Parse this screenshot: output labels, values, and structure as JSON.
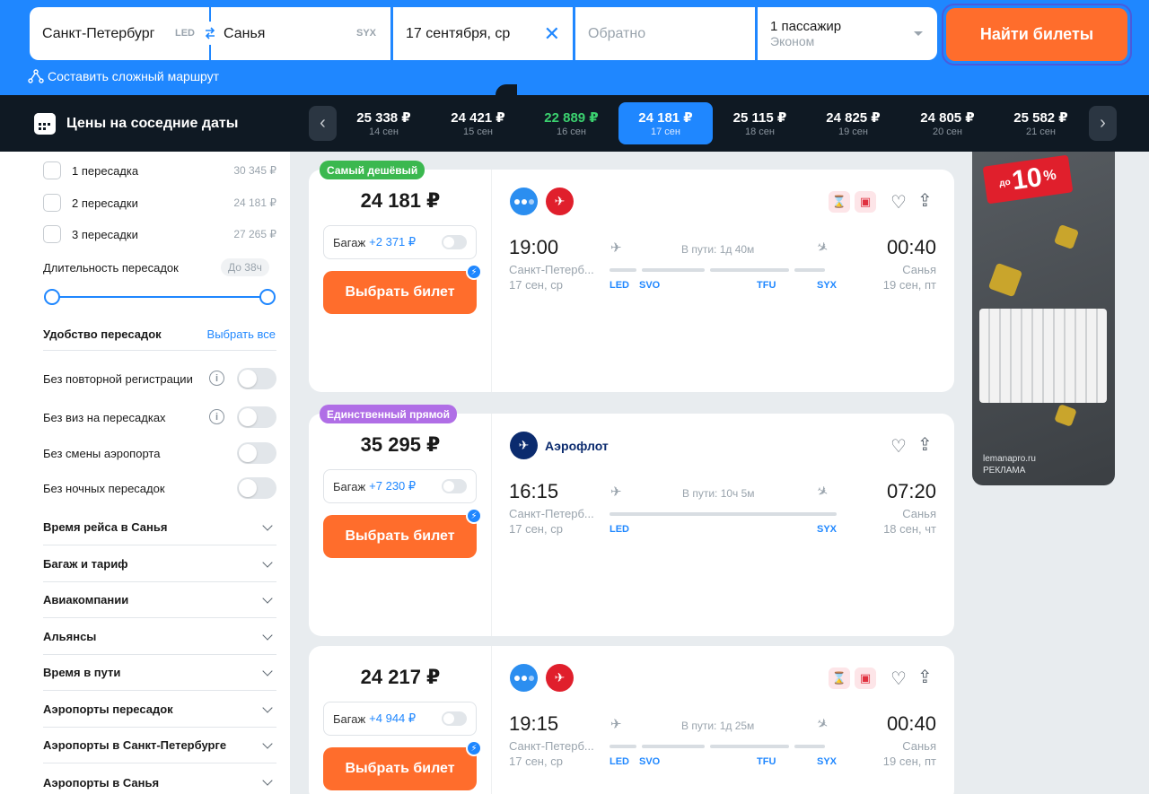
{
  "search": {
    "from_city": "Санкт-Петербург",
    "from_code": "LED",
    "to_city": "Санья",
    "to_code": "SYX",
    "date": "17 сентября, ср",
    "return_placeholder": "Обратно",
    "passengers": "1 пассажир",
    "class": "Эконом",
    "search_button": "Найти билеты",
    "complex_route": "Составить сложный маршрут"
  },
  "price_bar": {
    "title": "Цены на соседние даты",
    "dates": [
      {
        "price": "25 338 ₽",
        "date": "14 сен"
      },
      {
        "price": "24 421 ₽",
        "date": "15 сен"
      },
      {
        "price": "22 889 ₽",
        "date": "16 сен",
        "cheapest": true
      },
      {
        "price": "24 181 ₽",
        "date": "17 сен",
        "active": true
      },
      {
        "price": "25 115 ₽",
        "date": "18 сен"
      },
      {
        "price": "24 825 ₽",
        "date": "19 сен"
      },
      {
        "price": "24 805 ₽",
        "date": "20 сен"
      },
      {
        "price": "25 582 ₽",
        "date": "21 сен"
      }
    ]
  },
  "filters": {
    "stops": [
      {
        "label": "1 пересадка",
        "price": "30 345 ₽"
      },
      {
        "label": "2 пересадки",
        "price": "24 181 ₽"
      },
      {
        "label": "3 пересадки",
        "price": "27 265 ₽"
      }
    ],
    "duration_label": "Длительность пересадок",
    "duration_chip": "До 38ч",
    "convenience_title": "Удобство пересадок",
    "select_all": "Выбрать все",
    "toggles": [
      {
        "label": "Без повторной регистрации",
        "info": true
      },
      {
        "label": "Без виз на пересадках",
        "info": true
      },
      {
        "label": "Без смены аэропорта",
        "info": false
      },
      {
        "label": "Без ночных пересадок",
        "info": false
      }
    ],
    "accordions": [
      "Время рейса в Санья",
      "Багаж и тариф",
      "Авиакомпании",
      "Альянсы",
      "Время в пути",
      "Аэропорты пересадок",
      "Аэропорты в Санкт-Петербурге",
      "Аэропорты в Санья"
    ]
  },
  "results": [
    {
      "badge": "Самый дешёвый",
      "badge_color": "#3bb84f",
      "price": "24 181 ₽",
      "baggage": "Багаж",
      "baggage_price": "+2 371 ₽",
      "choose": "Выбрать билет",
      "dep_time": "19:00",
      "dep_city": "Санкт-Петерб...",
      "dep_date": "17 сен, ср",
      "arr_time": "00:40",
      "arr_city": "Санья",
      "arr_date": "19 сен, пт",
      "duration": "В пути: 1д 40м",
      "airports": [
        "LED",
        "SVO",
        "TFU",
        "SYX"
      ]
    },
    {
      "badge": "Единственный прямой",
      "badge_color": "#b06ee6",
      "price": "35 295 ₽",
      "airline": "Аэрофлот",
      "baggage": "Багаж",
      "baggage_price": "+7 230 ₽",
      "choose": "Выбрать билет",
      "dep_time": "16:15",
      "dep_city": "Санкт-Петерб...",
      "dep_date": "17 сен, ср",
      "arr_time": "07:20",
      "arr_city": "Санья",
      "arr_date": "18 сен, чт",
      "duration": "В пути: 10ч 5м",
      "airports": [
        "LED",
        "SYX"
      ]
    },
    {
      "price": "24 217 ₽",
      "baggage": "Багаж",
      "baggage_price": "+4 944 ₽",
      "choose": "Выбрать билет",
      "dep_time": "19:15",
      "dep_city": "Санкт-Петерб...",
      "dep_date": "17 сен, ср",
      "arr_time": "00:40",
      "arr_city": "Санья",
      "arr_date": "19 сен, пт",
      "duration": "В пути: 1д 25м",
      "airports": [
        "LED",
        "SVO",
        "TFU",
        "SYX"
      ]
    }
  ],
  "ad": {
    "tag_small": "до",
    "tag_big": "10",
    "tag_pct": "%",
    "site": "lemanapro.ru",
    "label": "РЕКЛАМА"
  },
  "colors": {
    "accent": "#1f87ff",
    "cta": "#ff6d2c",
    "dark": "#0f1923"
  }
}
